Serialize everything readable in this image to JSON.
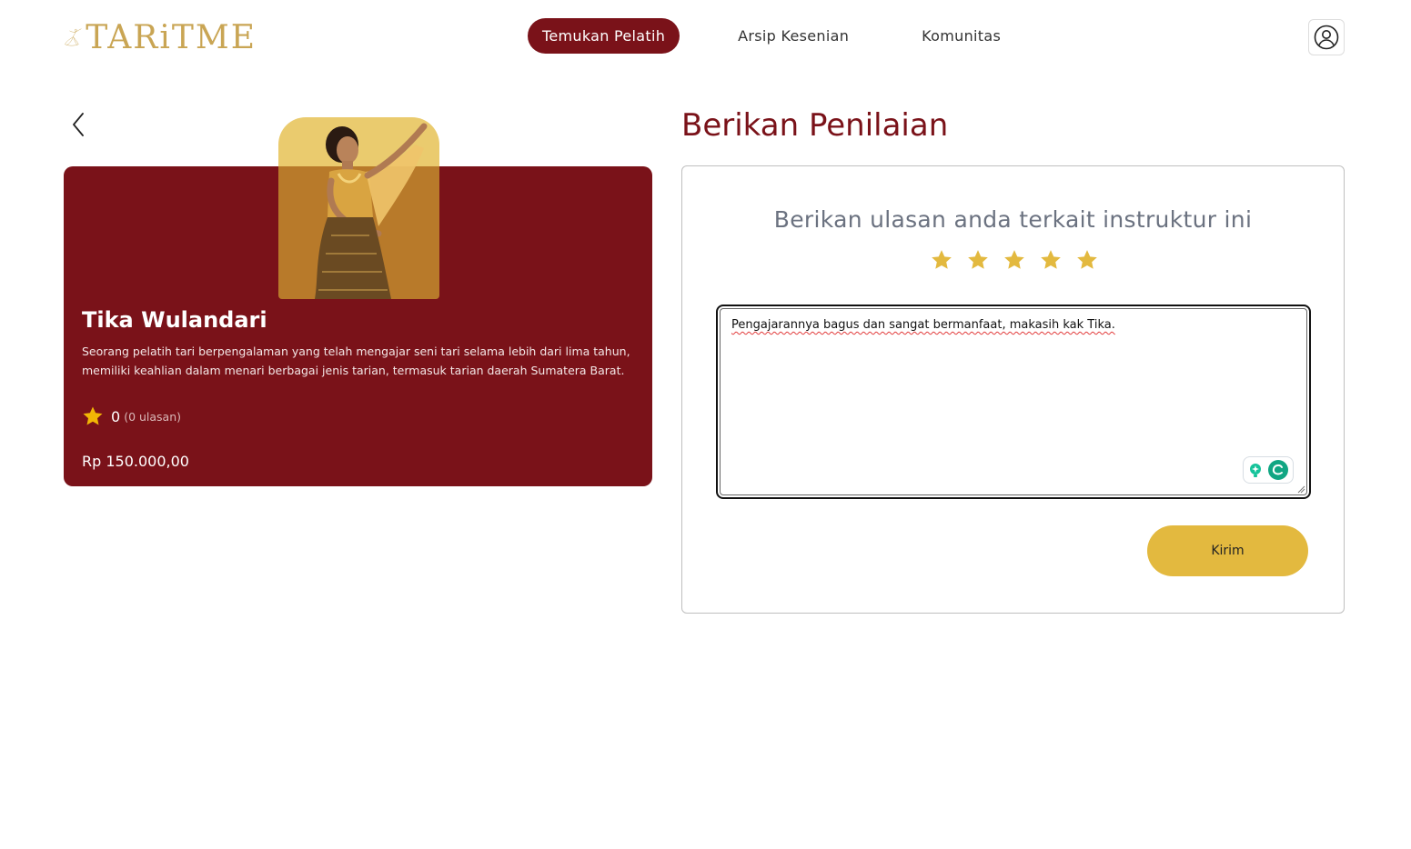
{
  "brand": {
    "name": "TARiTME"
  },
  "nav": {
    "items": [
      {
        "label": "Temukan Pelatih"
      },
      {
        "label": "Arsip Kesenian"
      },
      {
        "label": "Komunitas"
      }
    ]
  },
  "trainer": {
    "name": "Tika Wulandari",
    "description": "Seorang pelatih tari berpengalaman yang telah mengajar seni tari selama lebih dari lima tahun, memiliki keahlian dalam menari berbagai jenis tarian, termasuk tarian daerah Sumatera Barat.",
    "rating": "0",
    "review_count": "(0 ulasan)",
    "price": "Rp 150.000,00"
  },
  "review": {
    "title": "Berikan Penilaian",
    "prompt": "Berikan ulasan anda terkait instruktur ini",
    "stars_total": 5,
    "text": "Pengajarannya bagus dan sangat bermanfaat, makasih kak Tika.",
    "submit_label": "Kirim"
  },
  "colors": {
    "brand_maroon": "#7a1219",
    "gold": "#e3b93f",
    "star": "#e3b93f",
    "logo": "#c9a554"
  },
  "icons": [
    "dancer-logo-icon",
    "user-profile-icon",
    "chevron-left-icon",
    "star-icon",
    "grammar-assistant-icon"
  ]
}
